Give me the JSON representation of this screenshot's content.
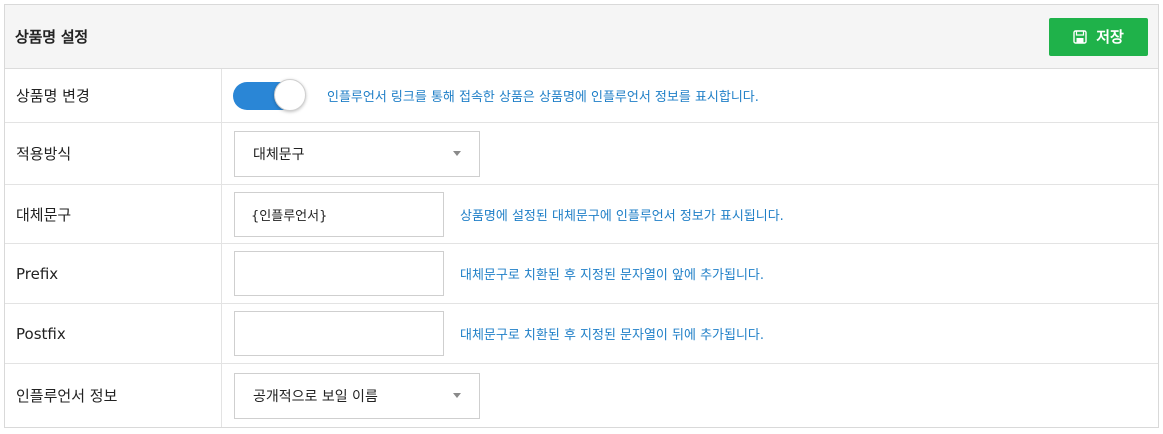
{
  "header": {
    "title": "상품명 설정",
    "save_label": "저장",
    "save_icon": "save-icon"
  },
  "rows": {
    "product_name_change": {
      "label": "상품명 변경",
      "toggle_on": true,
      "hint": "인플루언서 링크를 통해 접속한 상품은 상품명에 인플루언서 정보를 표시합니다."
    },
    "apply_method": {
      "label": "적용방식",
      "selected": "대체문구"
    },
    "replacement": {
      "label": "대체문구",
      "value": "{인플루언서}",
      "hint": "상품명에 설정된 대체문구에 인플루언서 정보가 표시됩니다."
    },
    "prefix": {
      "label": "Prefix",
      "value": "",
      "hint": "대체문구로 치환된 후 지정된 문자열이 앞에 추가됩니다."
    },
    "postfix": {
      "label": "Postfix",
      "value": "",
      "hint": "대체문구로 치환된 후 지정된 문자열이 뒤에 추가됩니다."
    },
    "influencer_info": {
      "label": "인플루언서 정보",
      "selected": "공개적으로 보일 이름"
    }
  },
  "colors": {
    "accent_green": "#1fb24a",
    "toggle_blue": "#2a86d6",
    "hint_blue": "#1f7fc7"
  }
}
